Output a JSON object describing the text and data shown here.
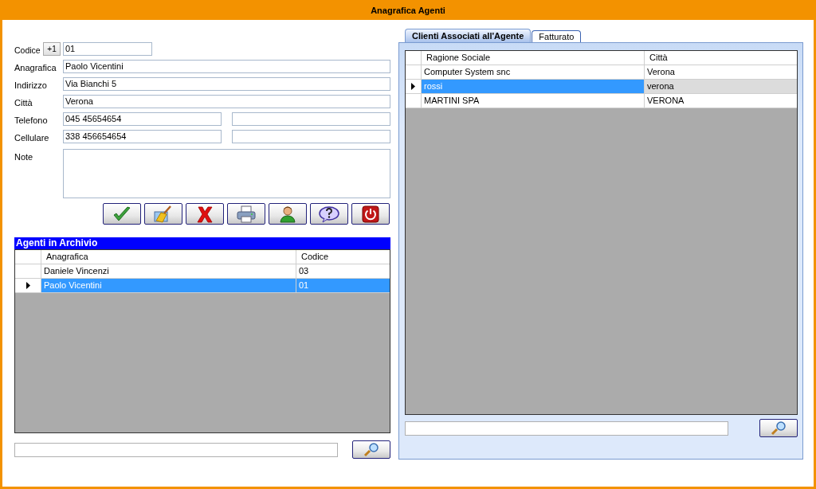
{
  "window": {
    "title": "Anagrafica Agenti"
  },
  "form": {
    "fields": [
      {
        "label": "Codice",
        "kind": "code",
        "button": "+1",
        "value": "01"
      },
      {
        "label": "Anagrafica",
        "kind": "full",
        "value": "Paolo Vicentini"
      },
      {
        "label": "Indirizzo",
        "kind": "full",
        "value": "Via Bianchi 5"
      },
      {
        "label": "Città",
        "kind": "full",
        "value": "Verona"
      },
      {
        "label": "Telefono",
        "kind": "pair",
        "value": "045 45654654"
      },
      {
        "label": "Cellulare",
        "kind": "pair",
        "value": "338 456654654"
      },
      {
        "label": "Note",
        "kind": "memo"
      }
    ]
  },
  "toolbar": {
    "buttons": [
      {
        "kind": "save"
      },
      {
        "kind": "clear"
      },
      {
        "kind": "delete"
      },
      {
        "kind": "print"
      },
      {
        "kind": "user"
      },
      {
        "kind": "help"
      },
      {
        "kind": "exit"
      }
    ]
  },
  "agents_grid": {
    "title": "Agenti in Archivio",
    "focused": true,
    "columns": [
      "Anagrafica",
      "Codice"
    ],
    "rows": [
      {
        "cells": [
          "Daniele Vincenzi",
          "03"
        ],
        "selected": false
      },
      {
        "cells": [
          "Paolo Vicentini",
          "01"
        ],
        "selected": true
      }
    ]
  },
  "tabs": [
    {
      "label": "Clienti Associati all'Agente",
      "selected": true
    },
    {
      "label": "Fatturato",
      "selected": false
    }
  ],
  "clients_grid": {
    "focused": false,
    "columns": [
      "Ragione Sociale",
      "Città"
    ],
    "rows": [
      {
        "cells": [
          "Computer System snc",
          "Verona"
        ],
        "selected": false
      },
      {
        "cells": [
          "rossi",
          "verona"
        ],
        "selected": true
      },
      {
        "cells": [
          "MARTINI SPA",
          "VERONA"
        ],
        "selected": false
      }
    ]
  }
}
